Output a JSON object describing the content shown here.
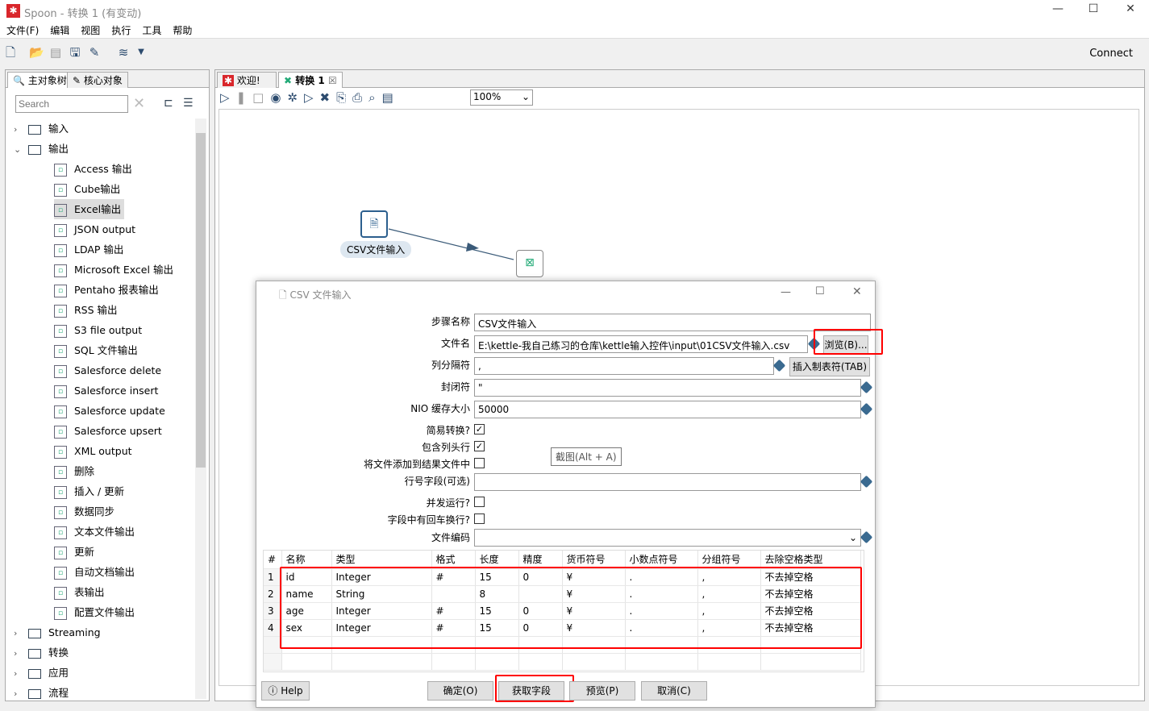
{
  "window": {
    "title": "Spoon - 转换 1 (有变动)",
    "minimize": "—",
    "maximize": "☐",
    "close": "✕"
  },
  "menu": [
    "文件(F)",
    "编辑",
    "视图",
    "执行",
    "工具",
    "帮助"
  ],
  "toolbar": {
    "connect": "Connect"
  },
  "left_panel": {
    "tabs": [
      "主对象树",
      "核心对象"
    ],
    "search_placeholder": "Search",
    "tree": [
      {
        "label": "输入",
        "type": "folder",
        "expanded": false
      },
      {
        "label": "输出",
        "type": "folder",
        "expanded": true
      },
      {
        "label": "Access 输出",
        "type": "step"
      },
      {
        "label": "Cube输出",
        "type": "step"
      },
      {
        "label": "Excel输出",
        "type": "step",
        "selected": true
      },
      {
        "label": "JSON output",
        "type": "step"
      },
      {
        "label": "LDAP 输出",
        "type": "step"
      },
      {
        "label": "Microsoft Excel 输出",
        "type": "step"
      },
      {
        "label": "Pentaho 报表输出",
        "type": "step"
      },
      {
        "label": "RSS 输出",
        "type": "step"
      },
      {
        "label": "S3 file output",
        "type": "step"
      },
      {
        "label": "SQL 文件输出",
        "type": "step"
      },
      {
        "label": "Salesforce delete",
        "type": "step"
      },
      {
        "label": "Salesforce insert",
        "type": "step"
      },
      {
        "label": "Salesforce update",
        "type": "step"
      },
      {
        "label": "Salesforce upsert",
        "type": "step"
      },
      {
        "label": "XML output",
        "type": "step"
      },
      {
        "label": "删除",
        "type": "step"
      },
      {
        "label": "插入 / 更新",
        "type": "step"
      },
      {
        "label": "数据同步",
        "type": "step"
      },
      {
        "label": "文本文件输出",
        "type": "step"
      },
      {
        "label": "更新",
        "type": "step"
      },
      {
        "label": "自动文档输出",
        "type": "step"
      },
      {
        "label": "表输出",
        "type": "step"
      },
      {
        "label": "配置文件输出",
        "type": "step"
      },
      {
        "label": "Streaming",
        "type": "folder",
        "expanded": false
      },
      {
        "label": "转换",
        "type": "folder",
        "expanded": false
      },
      {
        "label": "应用",
        "type": "folder",
        "expanded": false
      },
      {
        "label": "流程",
        "type": "folder",
        "expanded": false
      }
    ]
  },
  "editor": {
    "tabs": [
      "欢迎!",
      "转换 1"
    ],
    "zoom": "100%",
    "nodes": {
      "csv": "CSV文件输入",
      "excel_icon": "excel-output"
    }
  },
  "dialog": {
    "title": "CSV 文件输入",
    "fields": {
      "step_name_label": "步骤名称",
      "step_name": "CSV文件输入",
      "filename_label": "文件名",
      "filename": "E:\\kettle-我自己练习的仓库\\kettle输入控件\\input\\01CSV文件输入.csv",
      "browse": "浏览(B)...",
      "delimiter_label": "列分隔符",
      "delimiter": ",",
      "insert_tab": "插入制表符(TAB)",
      "enclosure_label": "封闭符",
      "enclosure": "\"",
      "nio_label": "NIO 缓存大小",
      "nio": "50000",
      "lazy_label": "简易转换?",
      "lazy": true,
      "header_label": "包含列头行",
      "header": true,
      "addfile_label": "将文件添加到结果文件中",
      "addfile": false,
      "rownum_label": "行号字段(可选)",
      "rownum": "",
      "parallel_label": "并发运行?",
      "parallel": false,
      "newline_label": "字段中有回车换行?",
      "newline": false,
      "encoding_label": "文件编码",
      "encoding": ""
    },
    "tooltip": "截图(Alt + A)",
    "table": {
      "headers": [
        "#",
        "名称",
        "类型",
        "格式",
        "长度",
        "精度",
        "货币符号",
        "小数点符号",
        "分组符号",
        "去除空格类型"
      ],
      "rows": [
        [
          "1",
          "id",
          "Integer",
          "#",
          "15",
          "0",
          "¥",
          ".",
          ",",
          "不去掉空格"
        ],
        [
          "2",
          "name",
          "String",
          "",
          "8",
          "",
          "¥",
          ".",
          ",",
          "不去掉空格"
        ],
        [
          "3",
          "age",
          "Integer",
          "#",
          "15",
          "0",
          "¥",
          ".",
          ",",
          "不去掉空格"
        ],
        [
          "4",
          "sex",
          "Integer",
          "#",
          "15",
          "0",
          "¥",
          ".",
          ",",
          "不去掉空格"
        ]
      ]
    },
    "buttons": {
      "help": "Help",
      "ok": "确定(O)",
      "get_fields": "获取字段",
      "preview": "预览(P)",
      "cancel": "取消(C)"
    }
  },
  "colors": {
    "highlight": "#ff0000",
    "accent": "#2c5f8e"
  }
}
